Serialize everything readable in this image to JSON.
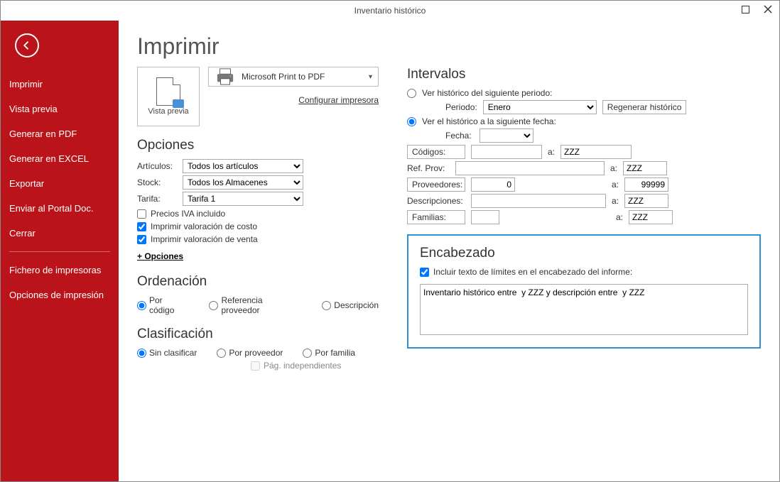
{
  "window": {
    "title": "Inventario histórico"
  },
  "sidebar": {
    "items": [
      "Imprimir",
      "Vista previa",
      "Generar en PDF",
      "Generar en EXCEL",
      "Exportar",
      "Enviar al Portal Doc.",
      "Cerrar"
    ],
    "footer": [
      "Fichero de impresoras",
      "Opciones de impresión"
    ]
  },
  "page": {
    "title": "Imprimir"
  },
  "preview": {
    "label": "Vista previa"
  },
  "printer": {
    "name": "Microsoft Print to PDF",
    "configure": "Configurar impresora"
  },
  "opciones": {
    "title": "Opciones",
    "articulos_lbl": "Artículos:",
    "articulos_val": "Todos los artículos",
    "stock_lbl": "Stock:",
    "stock_val": "Todos los Almacenes",
    "tarifa_lbl": "Tarifa:",
    "tarifa_val": "Tarifa 1",
    "precios_iva": "Precios IVA incluido",
    "val_costo": "Imprimir valoración de costo",
    "val_venta": "Imprimir valoración de venta",
    "more": "+ Opciones"
  },
  "ordenacion": {
    "title": "Ordenación",
    "por_codigo": "Por código",
    "ref_proveedor": "Referencia proveedor",
    "descripcion": "Descripción"
  },
  "clasificacion": {
    "title": "Clasificación",
    "sin_clasificar": "Sin clasificar",
    "por_proveedor": "Por proveedor",
    "por_familia": "Por familia",
    "pag_indep": "Pág. independientes"
  },
  "intervalos": {
    "title": "Intervalos",
    "opt_periodo": "Ver histórico del siguiente periodo:",
    "periodo_lbl": "Periodo:",
    "periodo_val": "Enero",
    "regen": "Regenerar histórico",
    "opt_fecha": "Ver el histórico a la siguiente fecha:",
    "fecha_lbl": "Fecha:",
    "fecha_val": "",
    "codigos_lbl": "Códigos:",
    "codigos_from": "",
    "codigos_to": "ZZZ",
    "refprov_lbl": "Ref. Prov:",
    "refprov_from": "",
    "refprov_to": "ZZZ",
    "proveedores_lbl": "Proveedores:",
    "prov_from": "0",
    "prov_to": "99999",
    "desc_lbl": "Descripciones:",
    "desc_from": "",
    "desc_to": "ZZZ",
    "familias_lbl": "Familias:",
    "fam_from": "",
    "fam_to": "ZZZ",
    "a": "a:"
  },
  "encabezado": {
    "title": "Encabezado",
    "incluir": "Incluir texto de límites en el encabezado del informe:",
    "texto": "Inventario histórico entre  y ZZZ y descripción entre  y ZZZ"
  }
}
